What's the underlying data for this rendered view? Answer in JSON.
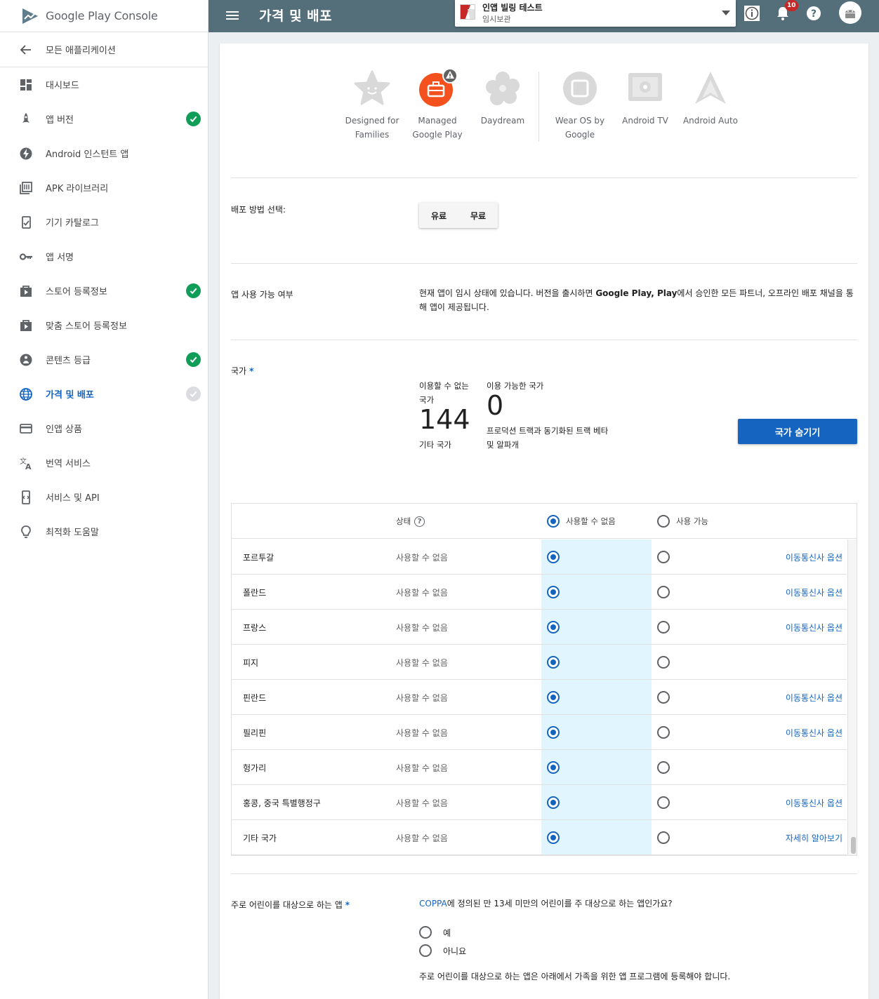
{
  "brand": {
    "name": "Google Play Console"
  },
  "sidebar": {
    "back_label": "모든 애플리케이션",
    "items": [
      {
        "label": "대시보드",
        "icon": "dashboard-icon",
        "check": "none"
      },
      {
        "label": "앱 버전",
        "icon": "rocket-icon",
        "check": "green"
      },
      {
        "label": "Android 인스턴트 앱",
        "icon": "bolt-icon",
        "check": "none"
      },
      {
        "label": "APK 라이브러리",
        "icon": "library-icon",
        "check": "none"
      },
      {
        "label": "기기 카탈로그",
        "icon": "device-catalog-icon",
        "check": "none"
      },
      {
        "label": "앱 서명",
        "icon": "key-icon",
        "check": "none"
      },
      {
        "label": "스토어 등록정보",
        "icon": "store-listing-icon",
        "check": "green"
      },
      {
        "label": "맞춤 스토어 등록정보",
        "icon": "custom-store-listing-icon",
        "check": "none"
      },
      {
        "label": "콘텐츠 등급",
        "icon": "content-rating-icon",
        "check": "green"
      },
      {
        "label": "가격 및 배포",
        "icon": "globe-icon",
        "check": "grey",
        "active": true
      },
      {
        "label": "인앱 상품",
        "icon": "credit-card-icon",
        "check": "none"
      },
      {
        "label": "번역 서비스",
        "icon": "translate-icon",
        "check": "none"
      },
      {
        "label": "서비스 및 API",
        "icon": "api-icon",
        "check": "none"
      },
      {
        "label": "최적화 도움말",
        "icon": "lightbulb-icon",
        "check": "none"
      }
    ]
  },
  "topbar": {
    "title": "가격 및 배포",
    "app_name": "인앱 빌링 테스트",
    "app_status": "임시보관",
    "notification_count": "10"
  },
  "programs": [
    {
      "line1": "Designed for",
      "line2": "Families"
    },
    {
      "line1": "Managed",
      "line2": "Google Play"
    },
    {
      "line1": "Daydream",
      "line2": ""
    },
    {
      "line1": "Wear OS by",
      "line2": "Google"
    },
    {
      "line1": "Android TV",
      "line2": ""
    },
    {
      "line1": "Android Auto",
      "line2": ""
    }
  ],
  "distribution": {
    "label": "배포 방법 선택:",
    "paid": "유료",
    "free": "무료"
  },
  "availability": {
    "label": "앱 사용 가능 여부",
    "text_before": "현재 앱이 임시 상태에 있습니다. 버전을 출시하면 ",
    "text_bold": "Google Play, Play",
    "text_after": "에서 승인한 모든 파트너, 오프라인 배포 채널을 통해 앱이 제공됩니다."
  },
  "countries": {
    "label": "국가",
    "unavailable_label_1": "이용할 수 없는",
    "unavailable_label_2": "국가",
    "unavailable_count": "144",
    "unavailable_sub": "기타 국가",
    "available_label": "이용 가능한 국가",
    "available_count": "0",
    "available_sub_1": "프로덕션 트랙과 동기화된 트랙 베타",
    "available_sub_2": "및 알파개",
    "hide_button": "국가 숨기기"
  },
  "table": {
    "header_status": "상태",
    "header_unavailable": "사용할 수 없음",
    "header_available": "사용 가능",
    "rows": [
      {
        "name": "포르투갈",
        "status": "사용할 수 없음",
        "link": "이동통신사 옵션"
      },
      {
        "name": "폴란드",
        "status": "사용할 수 없음",
        "link": "이동통신사 옵션"
      },
      {
        "name": "프랑스",
        "status": "사용할 수 없음",
        "link": "이동통신사 옵션"
      },
      {
        "name": "피지",
        "status": "사용할 수 없음",
        "link": ""
      },
      {
        "name": "핀란드",
        "status": "사용할 수 없음",
        "link": "이동통신사 옵션"
      },
      {
        "name": "필리핀",
        "status": "사용할 수 없음",
        "link": "이동통신사 옵션"
      },
      {
        "name": "헝가리",
        "status": "사용할 수 없음",
        "link": ""
      },
      {
        "name": "홍콩, 중국 특별행정구",
        "status": "사용할 수 없음",
        "link": "이동통신사 옵션"
      },
      {
        "name": "기타 국가",
        "status": "사용할 수 없음",
        "link": "자세히 알아보기"
      }
    ]
  },
  "children": {
    "label": "주로 어린이를 대상으로 하는 앱",
    "question_link": "COPPA",
    "question_rest": "에 정의된 만 13세 미만의 어린이를 주 대상으로 하는 앱인가요?",
    "yes": "예",
    "no": "아니요",
    "note": "주로 어린이를 대상으로 하는 앱은 아래에서 가족을 위한 앱 프로그램에 등록해야 합니다."
  },
  "colors": {
    "accent": "#1565c0",
    "topbar": "#546e7a",
    "highlight": "#e1f5fe",
    "check_green": "#0f9d58"
  }
}
